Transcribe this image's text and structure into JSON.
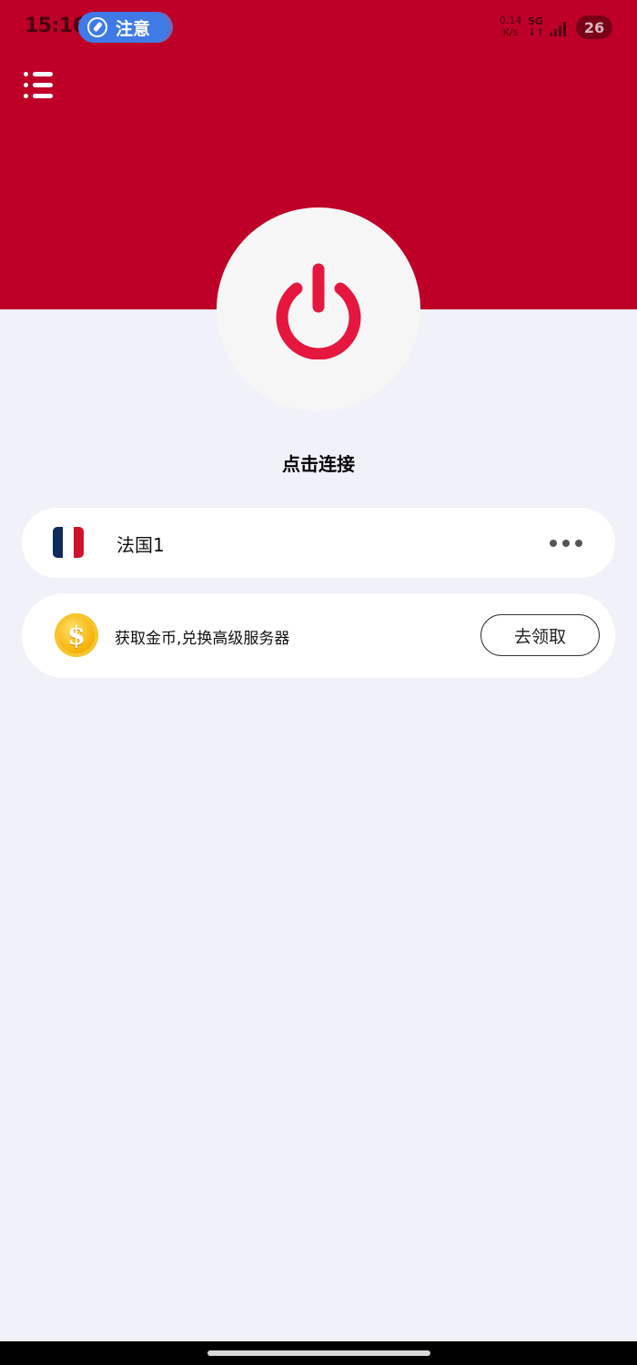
{
  "status_bar": {
    "time": "15:16",
    "notice_label": "注意",
    "net_speed_value": "0.14",
    "net_speed_unit": "K/s",
    "network_type": "5G",
    "battery_level": "26",
    "icons": [
      "rocket-icon",
      "signal-icon",
      "battery-icon"
    ]
  },
  "header": {
    "menu_icon": "list-menu-icon",
    "brand_color": "#be0029"
  },
  "connection": {
    "power_icon": "power-icon",
    "power_color": "#e5173f",
    "status_text": "点击连接"
  },
  "server": {
    "flag_icon": "france-flag-icon",
    "name": "法国1",
    "more_icon": "more-dots-icon"
  },
  "reward": {
    "coin_icon": "gold-coin-icon",
    "coin_symbol": "$",
    "text": "获取金币,兑换高级服务器",
    "button_label": "去领取"
  },
  "colors": {
    "background": "#f0f1f9",
    "card": "#ffffff",
    "notice_blue": "#3f7ae6"
  }
}
